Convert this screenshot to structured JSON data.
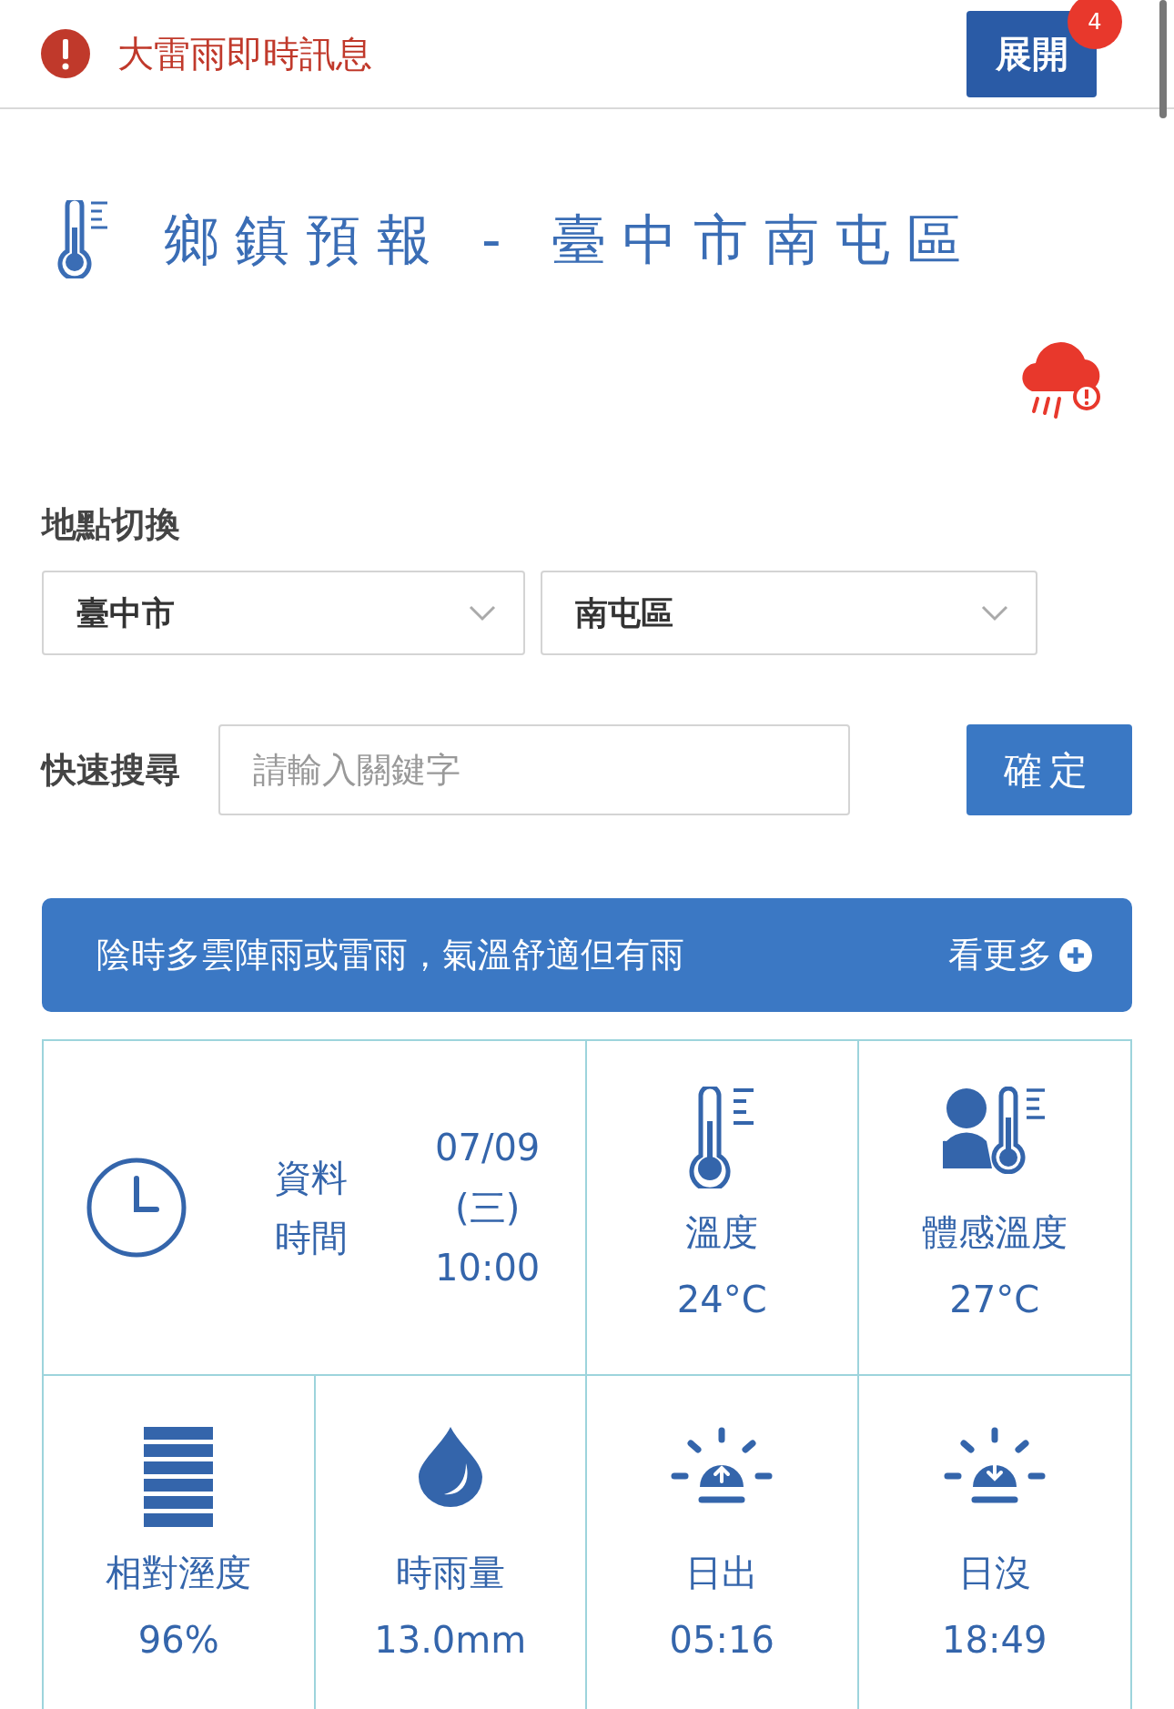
{
  "alert": {
    "title": "大雷雨即時訊息",
    "button": "展開",
    "badge": "4"
  },
  "heading": {
    "title": "鄉鎮預報 - 臺中市南屯區"
  },
  "location": {
    "label": "地點切換",
    "selects": [
      {
        "value": "臺中市"
      },
      {
        "value": "南屯區"
      }
    ]
  },
  "search": {
    "label": "快速搜尋",
    "placeholder": "請輸入關鍵字",
    "button": "確定"
  },
  "summary": {
    "text": "陰時多雲陣雨或雷雨，氣溫舒適但有雨",
    "more": "看更多"
  },
  "data_time": {
    "label_lines": [
      "資料",
      "時間"
    ],
    "value_lines": [
      "07/09",
      "(三)",
      "10:00"
    ]
  },
  "metrics": [
    {
      "kind": "temperature",
      "label": "溫度",
      "value": "24°C"
    },
    {
      "kind": "apparent",
      "label": "體感溫度",
      "value": "27°C"
    },
    {
      "kind": "humidity",
      "label": "相對溼度",
      "value": "96%"
    },
    {
      "kind": "rain",
      "label": "時雨量",
      "value": "13.0mm"
    },
    {
      "kind": "sunrise",
      "label": "日出",
      "value": "05:16"
    },
    {
      "kind": "sunset",
      "label": "日沒",
      "value": "18:49"
    }
  ]
}
